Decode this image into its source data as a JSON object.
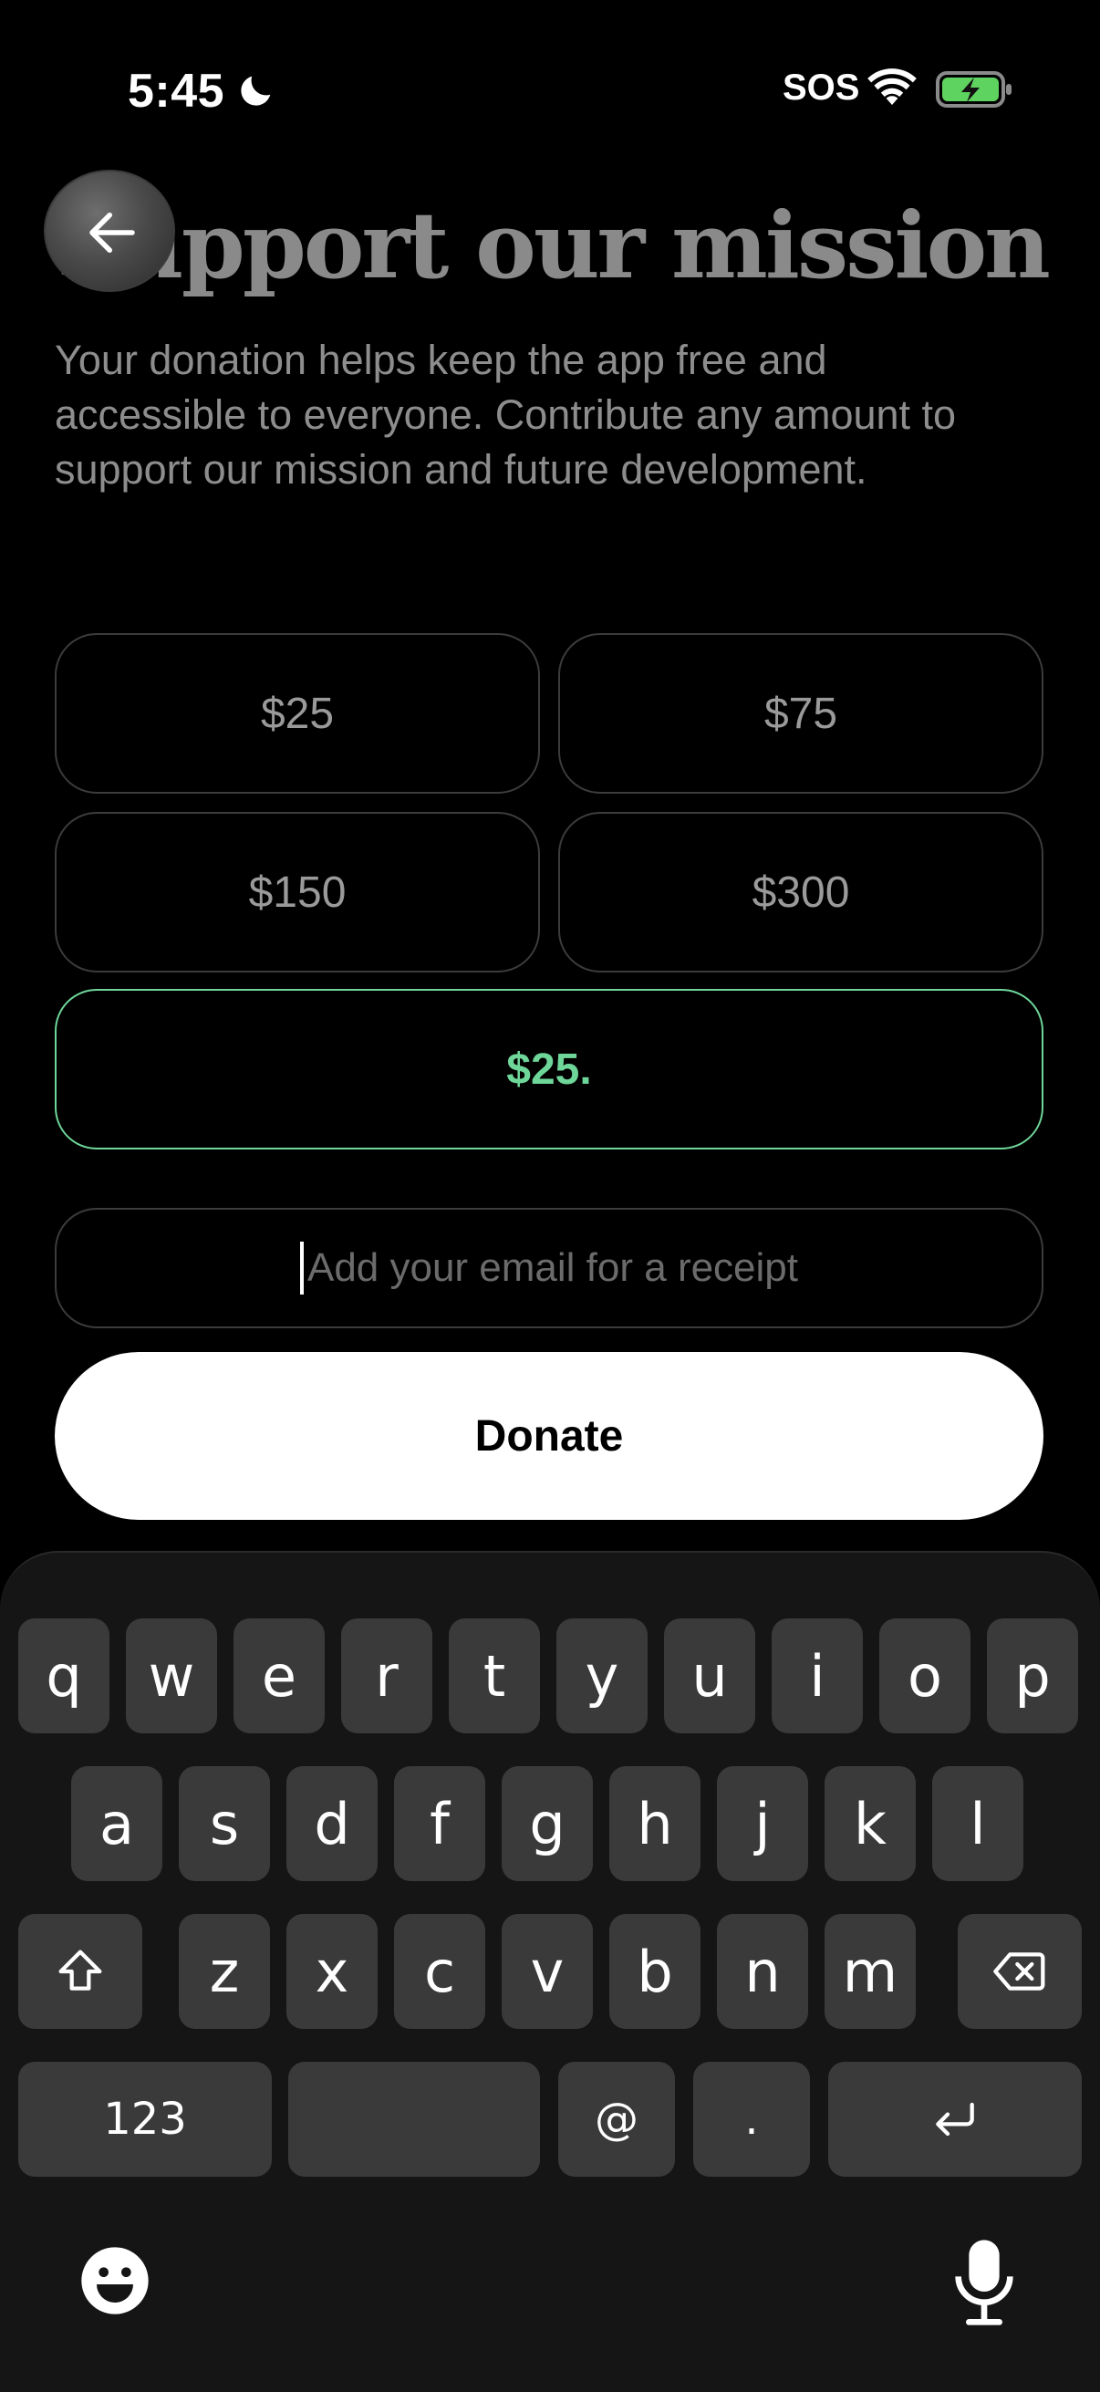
{
  "status_bar": {
    "time": "5:45",
    "sos": "SOS",
    "icons": [
      "moon-icon",
      "wifi-icon",
      "battery-charging-icon"
    ]
  },
  "header": {
    "title": "Support our mission",
    "subtitle": "Your donation helps keep the app free and accessible to everyone. Contribute any amount to support our mission and future development."
  },
  "amounts": [
    "$25",
    "$75",
    "$150",
    "$300"
  ],
  "custom_amount": "$25.",
  "email": {
    "placeholder": "Add your email for a receipt",
    "value": ""
  },
  "donate_label": "Donate",
  "colors": {
    "accent": "#6fd69a",
    "background": "#000000",
    "key": "#3a3a3a"
  },
  "keyboard": {
    "row1": [
      "q",
      "w",
      "e",
      "r",
      "t",
      "y",
      "u",
      "i",
      "o",
      "p"
    ],
    "row2": [
      "a",
      "s",
      "d",
      "f",
      "g",
      "h",
      "j",
      "k",
      "l"
    ],
    "row3": [
      "z",
      "x",
      "c",
      "v",
      "b",
      "n",
      "m"
    ],
    "numbers_key": "123",
    "at_key": "@",
    "period_key": "."
  }
}
